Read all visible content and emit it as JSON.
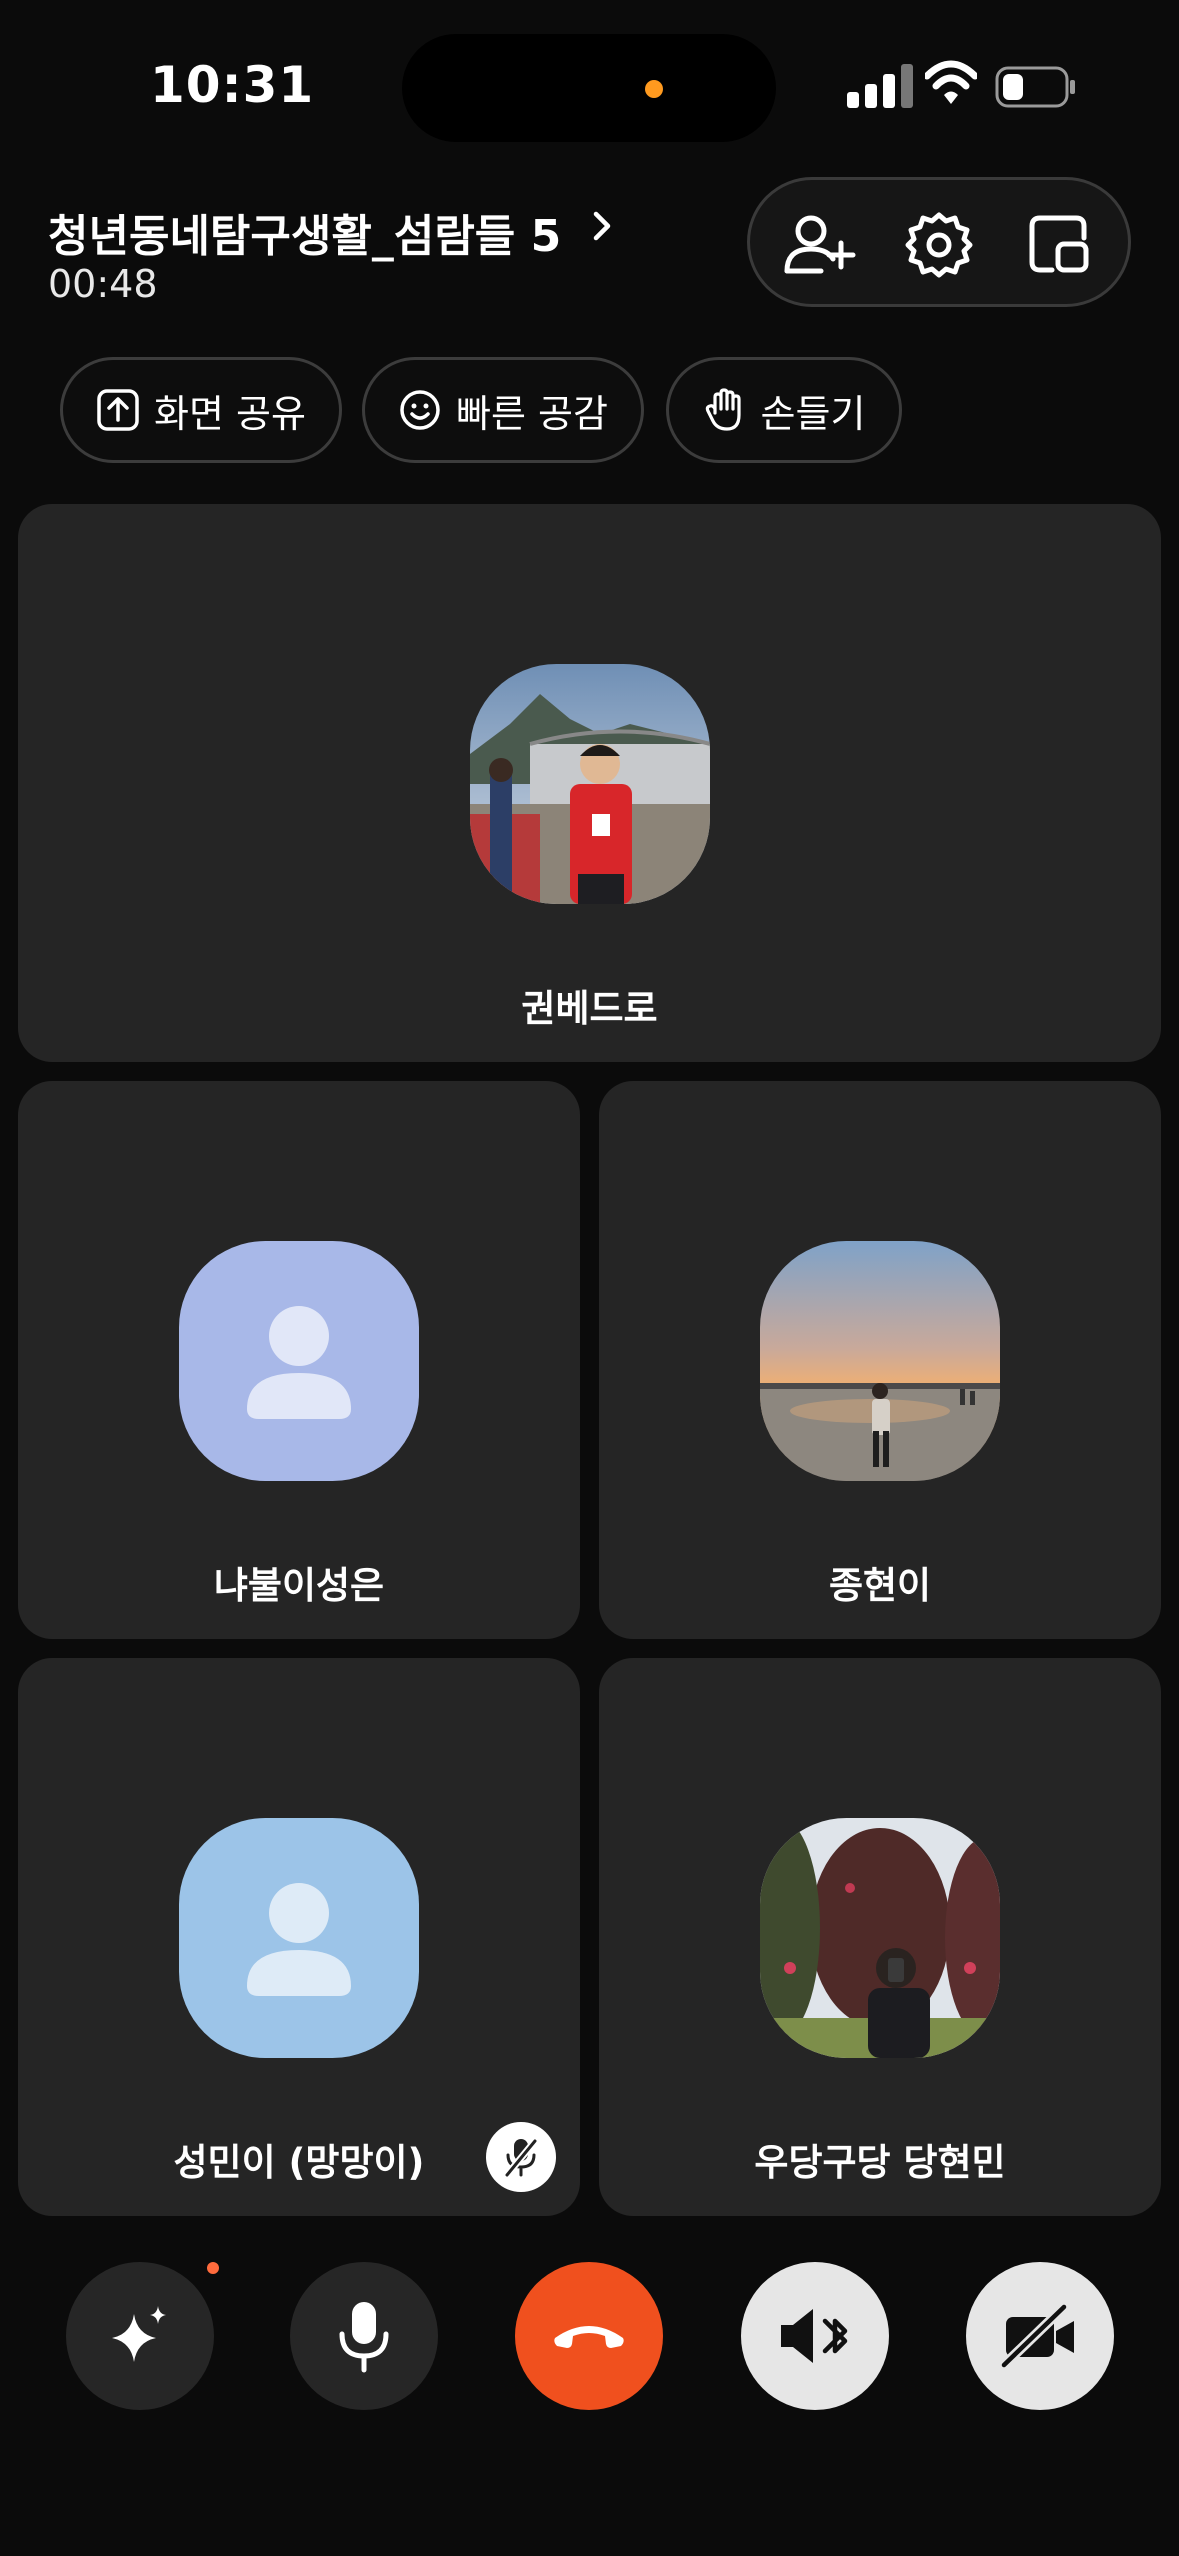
{
  "status_bar": {
    "time": "10:31"
  },
  "header": {
    "title": "청년동네탐구생활_섬람들 5",
    "duration": "00:48"
  },
  "chips": [
    {
      "label": "화면 공유"
    },
    {
      "label": "빠른 공감"
    },
    {
      "label": "손들기"
    }
  ],
  "participants": [
    {
      "name": "권베드로"
    },
    {
      "name": "냐불이성은"
    },
    {
      "name": "종현이"
    },
    {
      "name": "성민이 (망망이)",
      "muted": true
    },
    {
      "name": "우당구당 당현민"
    }
  ],
  "colors": {
    "end_call": "#f0501e",
    "avatar_lavender": "#a8b8e8",
    "avatar_blue": "#9cc4e8",
    "notification_dot": "#ff6b3d"
  }
}
